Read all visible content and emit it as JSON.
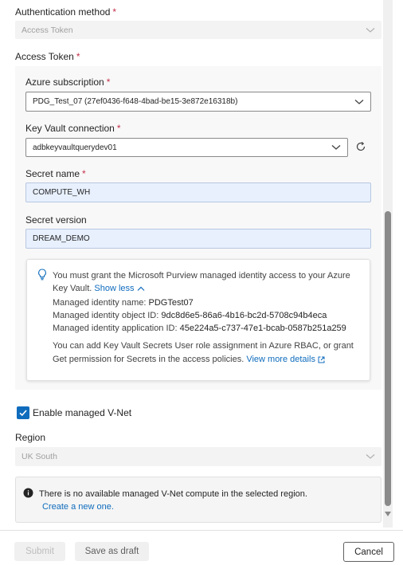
{
  "auth": {
    "label": "Authentication method",
    "value": "Access Token"
  },
  "access_token": {
    "label": "Access Token",
    "subscription": {
      "label": "Azure subscription",
      "value": "PDG_Test_07 (27ef0436-f648-4bad-be15-3e872e16318b)"
    },
    "keyvault": {
      "label": "Key Vault connection",
      "value": "adbkeyvaultquerydev01"
    },
    "secret_name": {
      "label": "Secret name",
      "value": "COMPUTE_WH"
    },
    "secret_version": {
      "label": "Secret version",
      "value": "DREAM_DEMO"
    },
    "info": {
      "line1": "You must grant the Microsoft Purview managed identity access to your Azure",
      "line2": "Key Vault.",
      "show_less": "Show less",
      "mi_name_label": "Managed identity name:",
      "mi_name_value": "PDGTest07",
      "mi_object_label": "Managed identity object ID:",
      "mi_object_value": "9dc8d6e5-86a6-4b16-bc2d-5708c94b4eca",
      "mi_app_label": "Managed identity application ID:",
      "mi_app_value": "45e224a5-c737-47e1-bcab-0587b251a259",
      "note_line1": "You can add Key Vault Secrets User role assignment in Azure RBAC, or grant",
      "note_line2": "Get permission for Secrets in the access policies.",
      "view_more": "View more details"
    }
  },
  "vnet": {
    "checkbox_label": "Enable managed V-Net",
    "checked": true
  },
  "region": {
    "label": "Region",
    "value": "UK South"
  },
  "notice": {
    "text": "There is no available managed V-Net compute in the selected region.",
    "link": "Create a new one."
  },
  "footer": {
    "submit": "Submit",
    "save_draft": "Save as draft",
    "cancel": "Cancel"
  },
  "colors": {
    "accent": "#0f6cbd",
    "required": "#c4314b"
  }
}
